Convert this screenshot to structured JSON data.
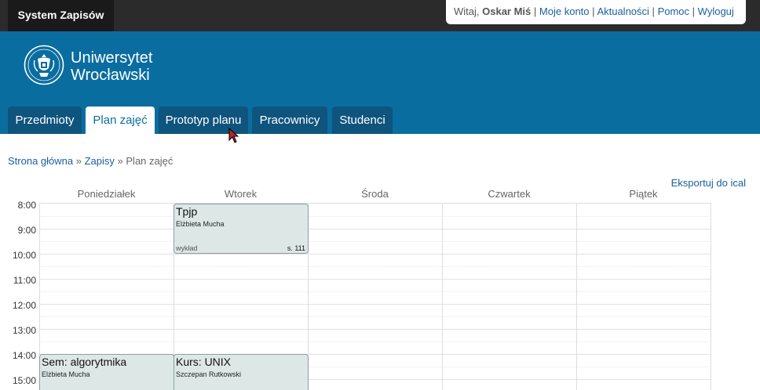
{
  "app": {
    "title": "System Zapisów"
  },
  "user_bar": {
    "greeting": "Witaj,",
    "user_name": "Oskar Miś",
    "links": [
      "Moje konto",
      "Aktualności",
      "Pomoc",
      "Wyloguj"
    ]
  },
  "university": {
    "name_line1": "Uniwersytet",
    "name_line2": "Wrocławski"
  },
  "tabs": [
    {
      "label": "Przedmioty",
      "active": false
    },
    {
      "label": "Plan zajęć",
      "active": true
    },
    {
      "label": "Prototyp planu",
      "active": false
    },
    {
      "label": "Pracownicy",
      "active": false
    },
    {
      "label": "Studenci",
      "active": false
    }
  ],
  "breadcrumb": {
    "home": "Strona główna",
    "sep1": "»",
    "section": "Zapisy",
    "sep2": "»",
    "current": "Plan zajęć"
  },
  "export_label": "Eksportuj do ical",
  "calendar": {
    "days": [
      "Poniedziałek",
      "Wtorek",
      "Środa",
      "Czwartek",
      "Piątek"
    ],
    "hours": [
      "8:00",
      "9:00",
      "10:00",
      "11:00",
      "12:00",
      "13:00",
      "14:00",
      "15:00"
    ],
    "events": [
      {
        "title": "Tpjp",
        "teacher": "Elżbieta Mucha",
        "type": "wykład",
        "room": "s. 111"
      },
      {
        "title": "Sem: algorytmika",
        "teacher": "Elżbieta Mucha",
        "type": "",
        "room": ""
      },
      {
        "title": "Kurs: UNIX",
        "teacher": "Szczepan Rutkowski",
        "type": "",
        "room": ""
      }
    ]
  },
  "colors": {
    "header": "#0a6d9f",
    "tab": "#0f547d",
    "topbar": "#2b2b2b",
    "link": "#1a5fa0",
    "event_bg": "#dde8e6"
  }
}
